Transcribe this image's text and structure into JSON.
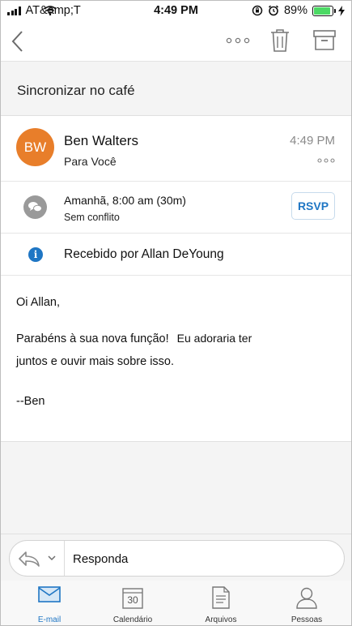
{
  "status_bar": {
    "carrier": "AT&amp;T",
    "time": "4:49 PM",
    "battery": "89%",
    "battery_level": 0.89
  },
  "toolbar": {
    "back_icon": "chevron-left-icon",
    "more_icon": "more-dots-icon",
    "delete_icon": "trash-icon",
    "archive_icon": "archive-icon"
  },
  "message": {
    "subject": "Sincronizar no café",
    "sender": {
      "initials": "BW",
      "name": "Ben Walters",
      "avatar_color": "#e87e2a"
    },
    "recipient": "Para Você",
    "time": "4:49 PM",
    "event": {
      "when": "Amanhã, 8:00 am (30m)",
      "conflict": "Sem conflito",
      "rsvp_label": "RSVP"
    },
    "received_notice": "Recebido por Allan DeYoung",
    "body": {
      "greeting": "Oi Allan,",
      "line1a": "Parabéns à sua nova função!",
      "line1b": "Eu adoraria ter",
      "line2": "juntos e ouvir mais sobre isso.",
      "signature": "--Ben"
    }
  },
  "reply": {
    "placeholder": "Responda"
  },
  "tabs": [
    {
      "label": "E-mail",
      "icon": "mail-icon",
      "active": true
    },
    {
      "label": "Calendário",
      "icon": "calendar-icon",
      "day": "30"
    },
    {
      "label": "Arquivos",
      "icon": "files-icon"
    },
    {
      "label": "Pessoas",
      "icon": "people-icon"
    }
  ],
  "colors": {
    "accent": "#1f76c4",
    "battery": "#4cd964",
    "icon_gray": "#9a9a9a"
  }
}
